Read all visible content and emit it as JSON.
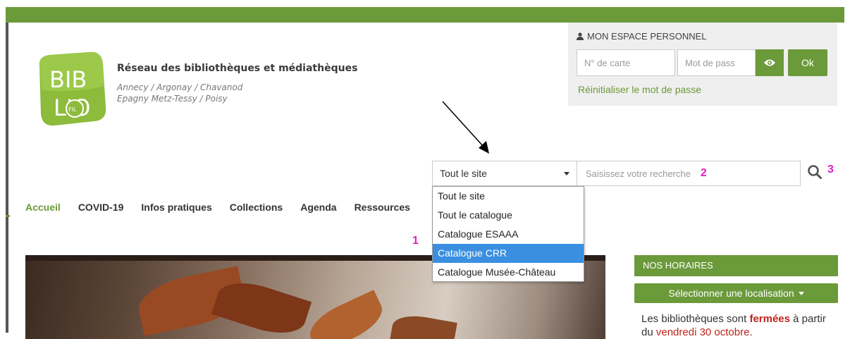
{
  "header": {
    "site_title": "Réseau des bibliothèques et médiathèques",
    "site_subtitle_1": "Annecy / Argonay / Chavanod",
    "site_subtitle_2": "Epagny Metz-Tessy / Poisy",
    "logo": {
      "line1": "BIB",
      "line2": "LIO",
      "badge": "FIL"
    }
  },
  "login": {
    "title": "MON ESPACE PERSONNEL",
    "card_placeholder": "N° de carte",
    "password_placeholder": "Mot de pass",
    "ok_label": "Ok",
    "reset_link": "Réinitialiser le mot de passe"
  },
  "search": {
    "scope_selected": "Tout le site",
    "placeholder": "Saisissez votre recherche",
    "options": [
      "Tout le site",
      "Tout le catalogue",
      "Catalogue ESAAA",
      "Catalogue CRR",
      "Catalogue Musée-Château"
    ],
    "highlighted_option": "Catalogue CRR"
  },
  "annotations": {
    "n1": "1",
    "n2": "2",
    "n3": "3"
  },
  "nav": {
    "items": [
      "Accueil",
      "COVID-19",
      "Infos pratiques",
      "Collections",
      "Agenda",
      "Ressources"
    ]
  },
  "hours": {
    "header": "NOS HORAIRES",
    "locate_button": "Sélectionner une localisation",
    "text_before": "Les bibliothèques sont ",
    "text_strong": "fermées",
    "text_middle": " à partir du ",
    "text_date": "vendredi 30 octobre",
    "text_end": "."
  },
  "colors": {
    "brand_green": "#6b9a3a",
    "highlight_blue": "#3b8fe0",
    "annotation_pink": "#e020c8",
    "alert_red": "#c0241b"
  }
}
